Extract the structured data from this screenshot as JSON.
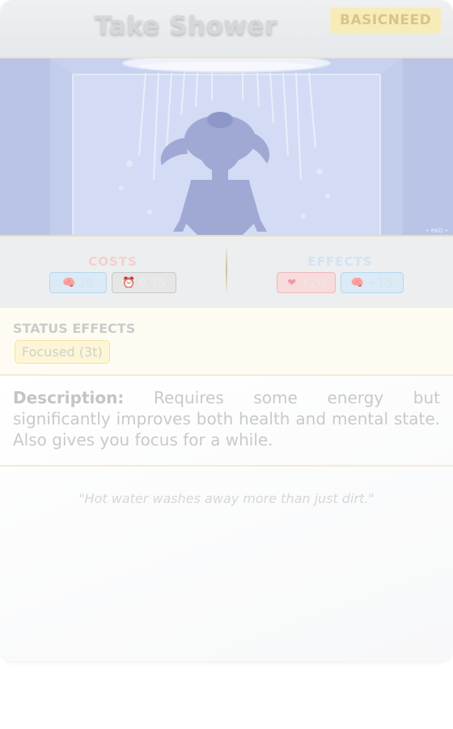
{
  "card": {
    "title": "Take Shower",
    "type_badge": "BASICNEED",
    "art_credit": "• RKD •",
    "costs": {
      "heading": "COSTS",
      "items": [
        {
          "icon": "brain-icon",
          "glyph": "🧠",
          "value": "10"
        },
        {
          "icon": "clock-icon",
          "glyph": "⏰",
          "value": "0.75"
        }
      ]
    },
    "effects": {
      "heading": "EFFECTS",
      "items": [
        {
          "icon": "heart-icon",
          "glyph": "❤",
          "value": "+20"
        },
        {
          "icon": "brain-icon",
          "glyph": "🧠",
          "value": "+15"
        }
      ]
    },
    "status_effects": {
      "heading": "STATUS EFFECTS",
      "chips": [
        "Focused (3t)"
      ]
    },
    "description": {
      "label": "Description:",
      "text": "Requires some energy but significantly improves both health and mental state. Also gives you focus for a while."
    },
    "quote": "\"Hot water washes away more than just dirt.\""
  },
  "colors": {
    "title": "#d5d7d9",
    "badge_bg": "#f7ecb9",
    "art_bg": "#c6d1ef",
    "costs_heading": "#f4cfcd",
    "effects_heading": "#d3e3f2",
    "status_bg": "#fefcf2"
  }
}
